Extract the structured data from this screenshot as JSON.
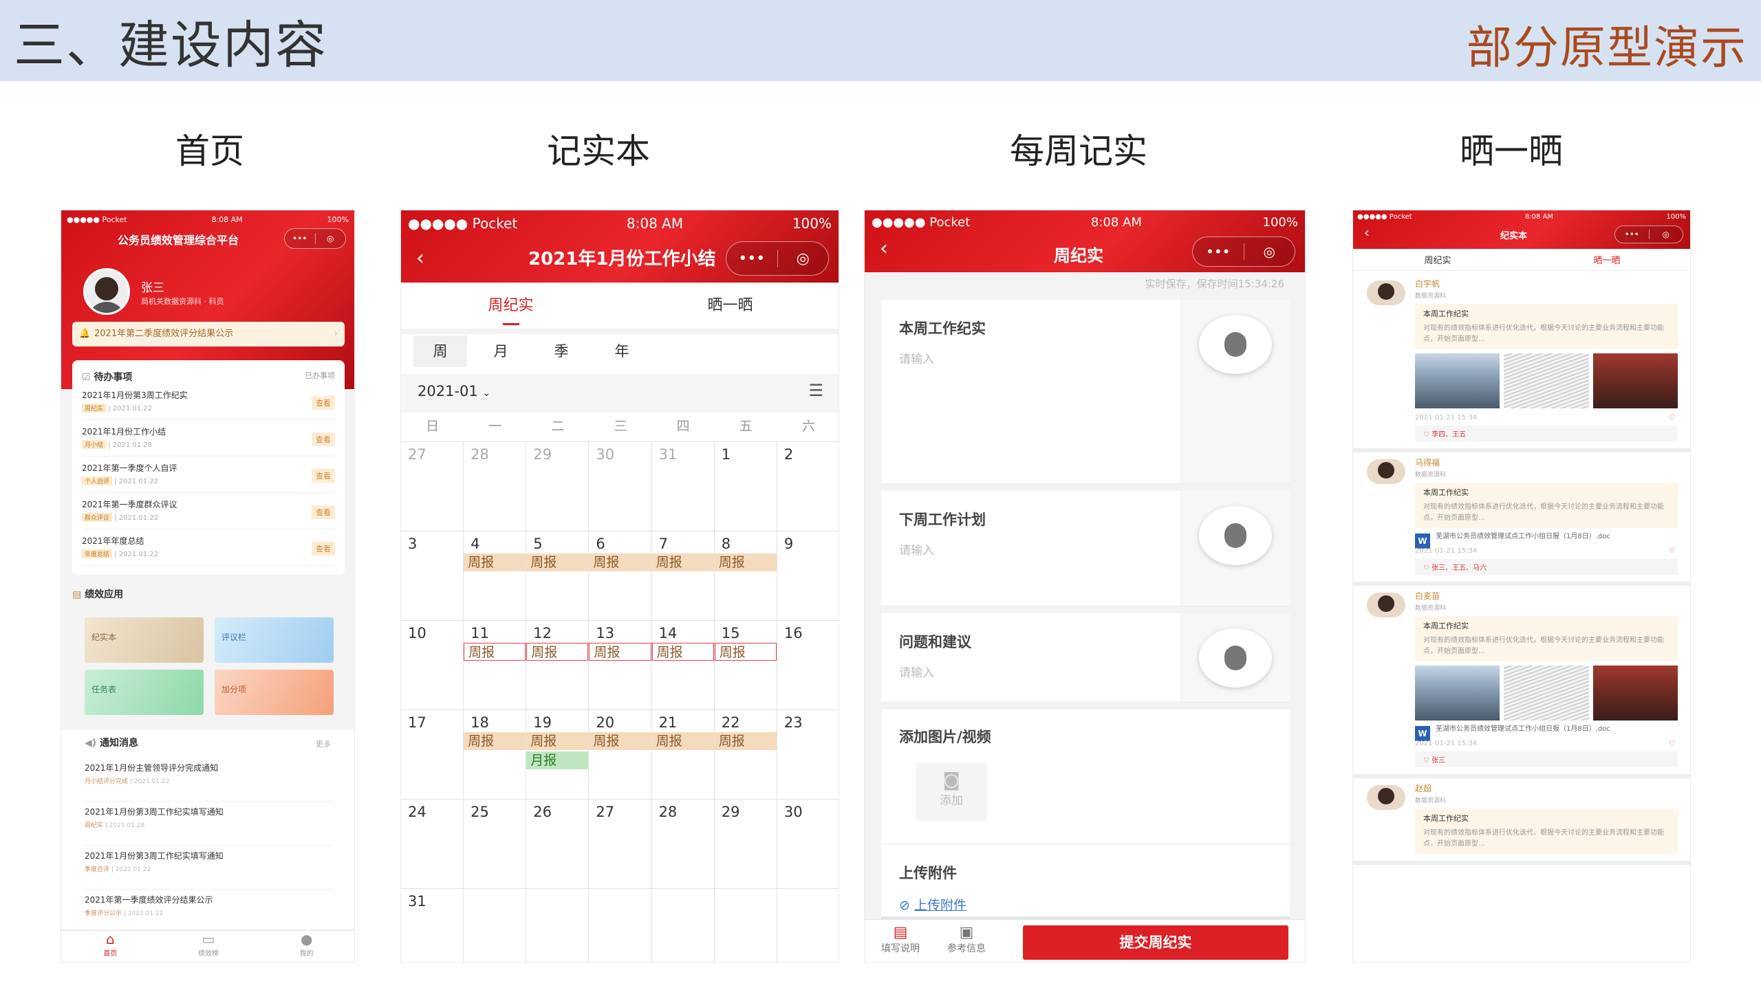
{
  "header": {
    "title": "三、建设内容",
    "subtitle": "部分原型演示"
  },
  "sections": [
    "首页",
    "记实本",
    "每周记实",
    "晒一晒"
  ],
  "status": {
    "carrier": "●●●●● Pocket",
    "carrier_small": "●●●●● Pocket",
    "time": "8:08 AM",
    "battery": "100%"
  },
  "capsule": {
    "more": "•••",
    "target": "◎"
  },
  "home": {
    "app_title": "公务员绩效管理综合平台",
    "user_name": "张三",
    "user_dept": "局机关数据资源科 · 科员",
    "notice": "2021年第二季度绩效评分结果公示",
    "todo_title": "待办事项",
    "done_link": "已办事项",
    "todos": [
      {
        "title": "2021年1月份第3周工作纪实",
        "tag": "周纪实",
        "date": "2021.01.22",
        "action": "查看"
      },
      {
        "title": "2021年1月份工作小结",
        "tag": "月小结",
        "date": "2021.01.28",
        "action": "查看"
      },
      {
        "title": "2021年第一季度个人自评",
        "tag": "个人自评",
        "date": "2021.01.22",
        "action": "查看"
      },
      {
        "title": "2021年第一季度群众评议",
        "tag": "群众评议",
        "date": "2021.01.22",
        "action": "查看"
      },
      {
        "title": "2021年年度总结",
        "tag": "年度总结",
        "date": "2021.01.22",
        "action": "查看"
      }
    ],
    "apps_title": "绩效应用",
    "apps": [
      "纪实本",
      "评议栏",
      "任务表",
      "加分项"
    ],
    "notify_title": "通知消息",
    "more": "更多",
    "notices": [
      {
        "title": "2021年1月份主管领导评分完成通知",
        "tag": "月小结评分完成",
        "date": "2021.01.22"
      },
      {
        "title": "2021年1月份第3周工作纪实填写通知",
        "tag": "周纪实",
        "date": "2021.01.28"
      },
      {
        "title": "2021年1月份第3周工作纪实填写通知",
        "tag": "季度自评",
        "date": "2021.01.22"
      },
      {
        "title": "2021年第一季度绩效评分结果公示",
        "tag": "季度评分公示",
        "date": "2021.01.22"
      }
    ],
    "tabbar": [
      "首页",
      "绩效榜",
      "我的"
    ]
  },
  "notebook": {
    "title": "2021年1月份工作小结",
    "tabs": [
      "周纪实",
      "晒一晒"
    ],
    "periods": [
      "周",
      "月",
      "季",
      "年"
    ],
    "month": "2021-01",
    "weekdays": [
      "日",
      "一",
      "二",
      "三",
      "四",
      "五",
      "六"
    ],
    "days": [
      [
        {
          "d": "27",
          "g": true
        },
        {
          "d": "28",
          "g": true
        },
        {
          "d": "29",
          "g": true
        },
        {
          "d": "30",
          "g": true
        },
        {
          "d": "31",
          "g": true
        },
        {
          "d": "1"
        },
        {
          "d": "2"
        }
      ],
      [
        {
          "d": "3"
        },
        {
          "d": "4",
          "r": "周报",
          "k": "fill"
        },
        {
          "d": "5",
          "r": "周报",
          "k": "fill"
        },
        {
          "d": "6",
          "r": "周报",
          "k": "fill"
        },
        {
          "d": "7",
          "r": "周报",
          "k": "fill"
        },
        {
          "d": "8",
          "r": "周报",
          "k": "fill"
        },
        {
          "d": "9"
        }
      ],
      [
        {
          "d": "10"
        },
        {
          "d": "11",
          "r": "周报",
          "k": "outl"
        },
        {
          "d": "12",
          "r": "周报",
          "k": "outl"
        },
        {
          "d": "13",
          "r": "周报",
          "k": "outl"
        },
        {
          "d": "14",
          "r": "周报",
          "k": "outl"
        },
        {
          "d": "15",
          "r": "周报",
          "k": "outl"
        },
        {
          "d": "16"
        }
      ],
      [
        {
          "d": "17"
        },
        {
          "d": "18",
          "r": "周报",
          "k": "fill"
        },
        {
          "d": "19",
          "r": "周报",
          "k": "fill",
          "m": "月报"
        },
        {
          "d": "20",
          "r": "周报",
          "k": "fill"
        },
        {
          "d": "21",
          "r": "周报",
          "k": "fill"
        },
        {
          "d": "22",
          "r": "周报",
          "k": "fill"
        },
        {
          "d": "23"
        }
      ],
      [
        {
          "d": "24"
        },
        {
          "d": "25"
        },
        {
          "d": "26"
        },
        {
          "d": "27"
        },
        {
          "d": "28"
        },
        {
          "d": "29"
        },
        {
          "d": "30"
        }
      ],
      [
        {
          "d": "31"
        },
        {
          "d": ""
        },
        {
          "d": ""
        },
        {
          "d": ""
        },
        {
          "d": ""
        },
        {
          "d": ""
        },
        {
          "d": ""
        }
      ]
    ]
  },
  "weekly": {
    "title": "周纪实",
    "autosave": "实时保存，保存时间15:34:26",
    "sections": [
      {
        "label": "本周工作纪实",
        "placeholder": "请输入"
      },
      {
        "label": "下周工作计划",
        "placeholder": "请输入"
      },
      {
        "label": "问题和建议",
        "placeholder": "请输入"
      }
    ],
    "media_label": "添加图片/视频",
    "media_add": "添加",
    "attach_label": "上传附件",
    "attach_link": "上传附件",
    "bottom": [
      "填写说明",
      "参考信息"
    ],
    "submit": "提交周纪实"
  },
  "share": {
    "title": "纪实本",
    "tabs": [
      "周纪实",
      "晒一晒"
    ],
    "posts": [
      {
        "name": "白宇帆",
        "dept": "数据资源科",
        "subject": "本周工作纪实",
        "body": "对现有的绩效指标体系进行优化迭代，根据今天讨论的主要业务流程和主要功能点，开始页面原型...",
        "file": "",
        "date": "2021-01-21  15:34",
        "likes": "李四、王五",
        "pics": true
      },
      {
        "name": "马得福",
        "dept": "数据资源科",
        "subject": "本周工作纪实",
        "body": "对现有的绩效指标体系进行优化迭代，根据今天讨论的主要业务流程和主要功能点，开始页面原型...",
        "file": "芜湖市公务员绩效管理试点工作小组日报（1月8日）.doc",
        "date": "2021-01-21  15:34",
        "likes": "张三、王五、马六",
        "pics": false
      },
      {
        "name": "白麦苗",
        "dept": "数据资源科",
        "subject": "本周工作纪实",
        "body": "对现有的绩效指标体系进行优化迭代，根据今天讨论的主要业务流程和主要功能点，开始页面原型...",
        "file": "芜湖市公务员绩效管理试点工作小组日报（1月8日）.doc",
        "date": "2021-01-21  15:34",
        "likes": "张三",
        "pics": true
      },
      {
        "name": "赵超",
        "dept": "数据资源科",
        "subject": "本周工作纪实",
        "body": "对现有的绩效指标体系进行优化迭代，根据今天讨论的主要业务流程和主要功能点，开始页面原型...",
        "file": "",
        "date": "",
        "likes": "",
        "pics": false
      }
    ]
  }
}
